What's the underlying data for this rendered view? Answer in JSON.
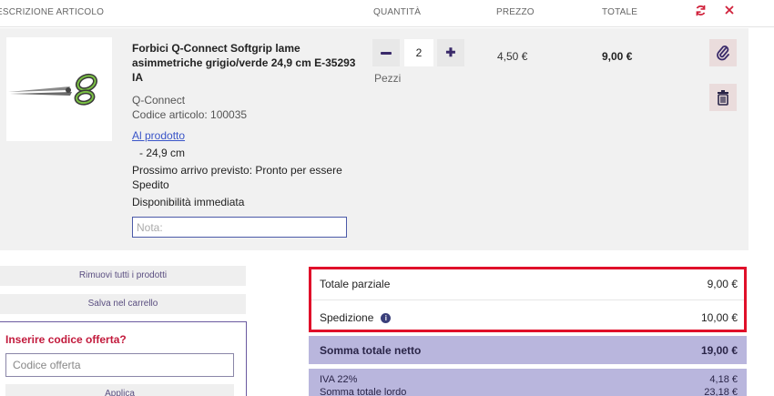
{
  "header": {
    "description": "ESCRIZIONE ARTICOLO",
    "quantity": "QUANTITÀ",
    "price": "PREZZO",
    "total": "TOTALE",
    "refresh_icon": "refresh-icon",
    "close_icon": "close-icon"
  },
  "item": {
    "title": "Forbici Q-Connect Softgrip lame asimmetriche grigio/verde 24,9 cm E-35293 IA",
    "brand": "Q-Connect",
    "code": "Codice articolo: 100035",
    "product_link": "Al prodotto",
    "variant": "- 24,9 cm",
    "arrival": "Prossimo arrivo previsto: Pronto per essere Spedito",
    "availability": "Disponibilità immediata",
    "note_placeholder": "Nota:",
    "quantity": "2",
    "unit": "Pezzi",
    "price": "4,50 €",
    "line_total": "9,00 €",
    "plus_glyph": "✚",
    "attach_icon": "paperclip-icon",
    "delete_icon": "trash-icon"
  },
  "actions": {
    "remove_all": "Rimuovi tutti i prodotti",
    "save_cart": "Salva nel carrello"
  },
  "coupon": {
    "title": "Inserire codice offerta?",
    "placeholder": "Codice offerta",
    "apply": "Applica"
  },
  "summary": {
    "subtotal_label": "Totale parziale",
    "subtotal_value": "9,00 €",
    "shipping_label": "Spedizione",
    "shipping_info": "i",
    "shipping_value": "10,00 €",
    "net_label": "Somma totale netto",
    "net_value": "19,00 €",
    "vat_label": "IVA 22%",
    "vat_value": "4,18 €",
    "gross_label": "Somma totale lordo",
    "gross_value": "23,18 €"
  },
  "colors": {
    "accent_red": "#e0102a",
    "summary_band": "#b9b6dd",
    "link_blue": "#3a55c8"
  }
}
